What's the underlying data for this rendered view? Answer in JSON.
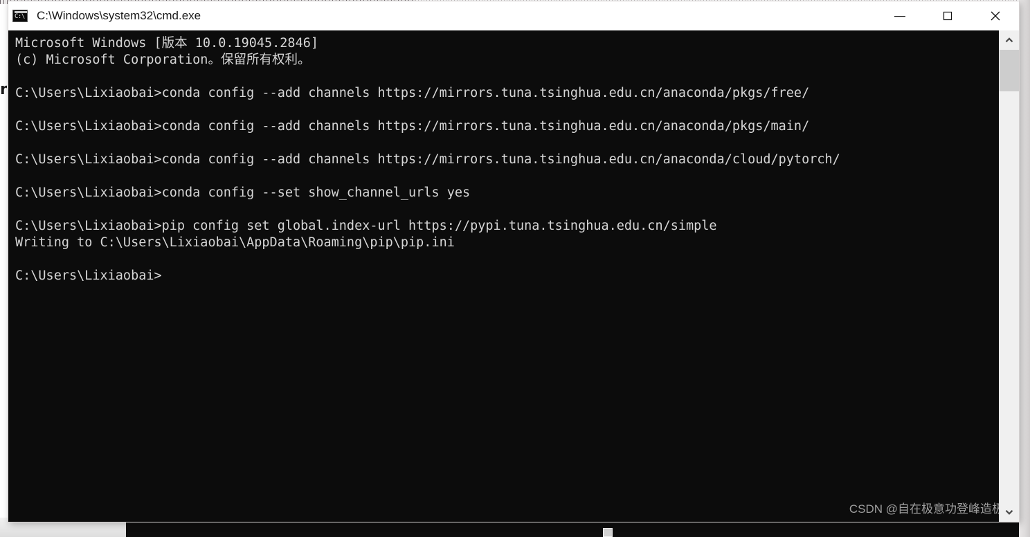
{
  "window": {
    "title": "C:\\Windows\\system32\\cmd.exe",
    "icon": "cmd-console-icon",
    "icon_prompt_text": "C:\\",
    "controls": {
      "minimize": "minimize-button",
      "maximize": "maximize-button",
      "close": "close-button"
    }
  },
  "console": {
    "background_color": "#0c0c0c",
    "text_color": "#d6d6d6",
    "prompt": "C:\\Users\\Lixiaobai>",
    "lines": [
      "Microsoft Windows [版本 10.0.19045.2846]",
      "(c) Microsoft Corporation。保留所有权利。",
      "",
      "C:\\Users\\Lixiaobai>conda config --add channels https://mirrors.tuna.tsinghua.edu.cn/anaconda/pkgs/free/",
      "",
      "C:\\Users\\Lixiaobai>conda config --add channels https://mirrors.tuna.tsinghua.edu.cn/anaconda/pkgs/main/",
      "",
      "C:\\Users\\Lixiaobai>conda config --add channels https://mirrors.tuna.tsinghua.edu.cn/anaconda/cloud/pytorch/",
      "",
      "C:\\Users\\Lixiaobai>conda config --set show_channel_urls yes",
      "",
      "C:\\Users\\Lixiaobai>pip config set global.index-url https://pypi.tuna.tsinghua.edu.cn/simple",
      "Writing to C:\\Users\\Lixiaobai\\AppData\\Roaming\\pip\\pip.ini",
      "",
      "C:\\Users\\Lixiaobai>"
    ]
  },
  "watermark": {
    "text": "CSDN @自在极意功登峰造极"
  },
  "scrollbar": {
    "up_arrow": "chevron-up-icon",
    "down_arrow": "chevron-down-icon"
  }
}
